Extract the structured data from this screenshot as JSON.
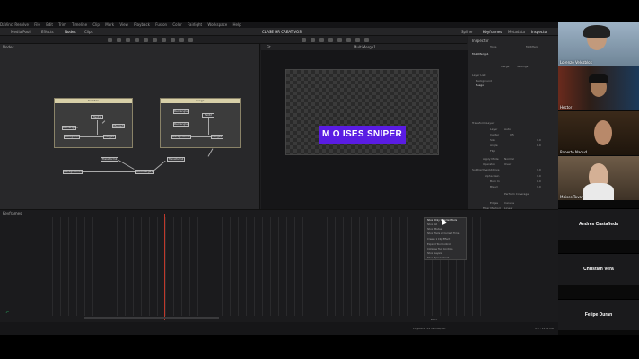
{
  "menubar": {
    "items": [
      "DaVinci Resolve",
      "File",
      "Edit",
      "Trim",
      "Timeline",
      "Clip",
      "Mark",
      "View",
      "Playback",
      "Fusion",
      "Color",
      "Fairlight",
      "Workspace",
      "Help"
    ]
  },
  "toolbar": {
    "left_items": [
      "Media Pool",
      "Effects",
      "Nodes",
      "Clips"
    ],
    "project_title": "CLASE HR CREATIVOS",
    "right_items": [
      "Spline",
      "Keyframes",
      "Metadata",
      "Inspector"
    ]
  },
  "nodes_panel": {
    "title": "Nodes",
    "groups": [
      {
        "title": "Sombra",
        "nodes": [
          "Text1",
          "Merge3",
          "Background1",
          "Rectangle1",
          "Merge1"
        ]
      },
      {
        "title": "Fuego",
        "nodes": [
          "Rectangle2",
          "Rectangle3",
          "Text2",
          "Background2",
          "Merge2"
        ]
      }
    ],
    "loose_nodes": [
      "Transform1",
      "Background3",
      "MultiMerge1",
      "Transform2"
    ]
  },
  "viewer": {
    "title": "MultiMerge1",
    "title_card_text": "M O ISES SNIPER",
    "zoom": "Fit",
    "frame": "42.0"
  },
  "inspector": {
    "title": "Inspector",
    "tabs": [
      "Tools",
      "Modifiers"
    ],
    "node_name": "MultiMerge1",
    "subtabs": [
      "Merge",
      "Settings"
    ],
    "layer_list_header": "Layer List",
    "layers": [
      "Background",
      "Fuego"
    ],
    "section": "Transform Layer",
    "fields": [
      {
        "label": "Layer",
        "value": "Auto"
      },
      {
        "label": "Center",
        "value": "0.5"
      },
      {
        "label": "Size",
        "value": "1.0"
      },
      {
        "label": "Angle",
        "value": "0.0"
      },
      {
        "label": "Flip",
        "value": ""
      },
      {
        "label": "Apply Mode",
        "value": "Normal"
      },
      {
        "label": "Operator",
        "value": "Over"
      },
      {
        "label": "Subtractive/Additive",
        "value": "1.0"
      },
      {
        "label": "Alpha Gain",
        "value": "1.0"
      },
      {
        "label": "Burn In",
        "value": "0.0"
      },
      {
        "label": "Blend",
        "value": "1.0"
      },
      {
        "label": "Edges",
        "value": "Canvas"
      },
      {
        "label": "Filter Method",
        "value": "Linear"
      }
    ],
    "checkbox_label": "Perform Coverage",
    "invert_label": "Invert Transform"
  },
  "keyframes": {
    "title": "Keyframes",
    "context_menu": [
      "Show Only Selected Tools",
      "Show All",
      "Show Modes",
      "Show Tools at Current Time",
      "Create 1 Clip Effect",
      "Expand Tool Controls",
      "Collapse Tool Controls",
      "Show Layers",
      "Show Spreadsheet"
    ],
    "time_label": "Time"
  },
  "statusbar": {
    "text": "Playback: 24 frames/sec",
    "right_text": "9% - 2274 MB"
  },
  "participants": {
    "video": [
      {
        "name": "Lorenzo Velezblox",
        "bg": "#8a9fb3"
      },
      {
        "name": "Hector",
        "bg": "#3a2a20"
      },
      {
        "name": "Roberto Nadud",
        "bg": "#2b1f14"
      },
      {
        "name": "Moises Tovar",
        "bg": "#5a4a38"
      }
    ],
    "names_only": [
      "Andres Castañeda",
      "Christian Vera",
      "Felipe Duran"
    ]
  }
}
